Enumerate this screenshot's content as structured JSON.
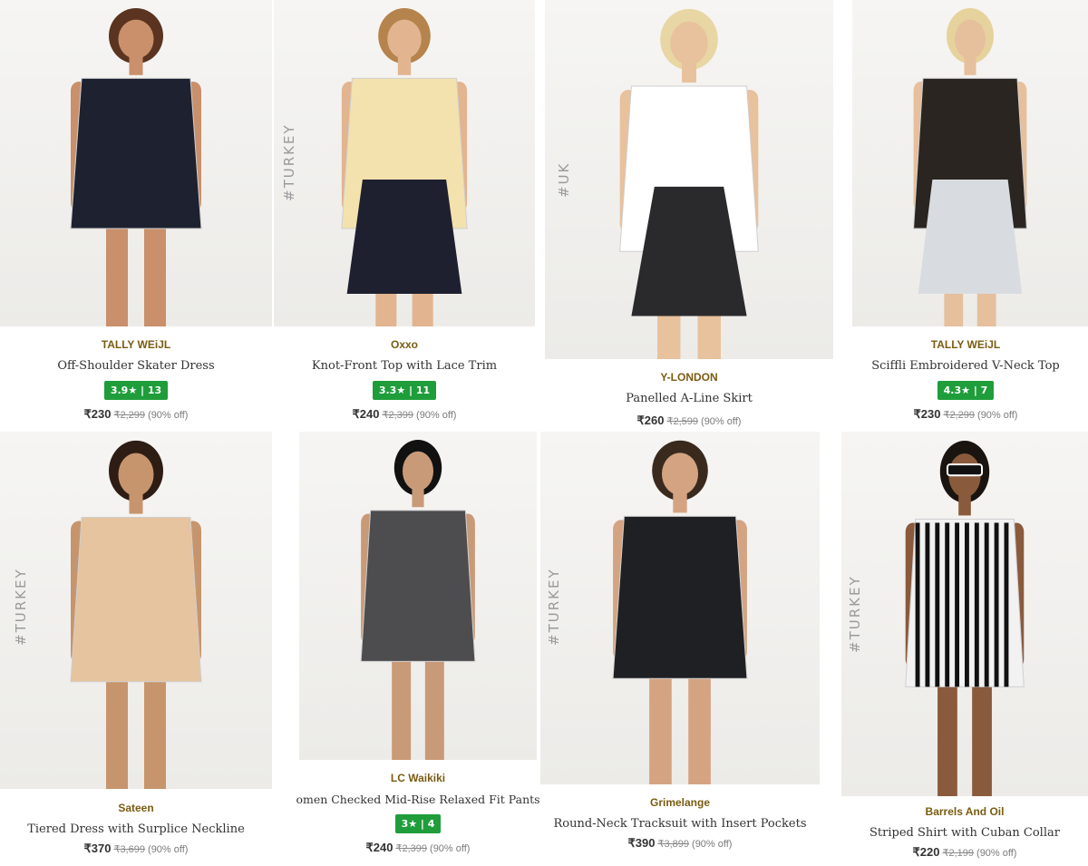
{
  "products": [
    {
      "brand": "TALLY WEiJL",
      "title": "Off-Shoulder Skater Dress",
      "rating": "3.9★ | 13",
      "price": "₹230",
      "mrp": "₹2,299",
      "discount": "(90% off)",
      "tag": "",
      "colors": {
        "outfit": "#1d2130",
        "skin": "#c9906b",
        "hair": "#5a3420"
      }
    },
    {
      "brand": "Oxxo",
      "title": "Knot-Front Top with Lace Trim",
      "rating": "3.3★ | 11",
      "price": "₹240",
      "mrp": "₹2,399",
      "discount": "(90% off)",
      "tag": "#TURKEY",
      "colors": {
        "outfit": "#f3e2ad",
        "skin": "#e2b48f",
        "hair": "#b5834c"
      }
    },
    {
      "brand": "Y-LONDON",
      "title": "Panelled A-Line Skirt",
      "rating": "",
      "price": "₹260",
      "mrp": "₹2,599",
      "discount": "(90% off)",
      "tag": "#UK",
      "colors": {
        "outfit": "#ffffff",
        "skin": "#e8c19d",
        "hair": "#e8d6a4"
      }
    },
    {
      "brand": "TALLY WEiJL",
      "title": "Sciffli Embroidered V-Neck Top",
      "rating": "4.3★ | 7",
      "price": "₹230",
      "mrp": "₹2,299",
      "discount": "(90% off)",
      "tag": "",
      "colors": {
        "outfit": "#2a2520",
        "skin": "#e6bf9c",
        "hair": "#e6d29c"
      }
    },
    {
      "brand": "Sateen",
      "title": "Tiered Dress with Surplice Neckline",
      "rating": "",
      "price": "₹370",
      "mrp": "₹3,699",
      "discount": "(90% off)",
      "tag": "#TURKEY",
      "colors": {
        "outfit": "#e5c49f",
        "skin": "#c7956d",
        "hair": "#2d1d14"
      }
    },
    {
      "brand": "LC Waikiki",
      "title": "omen Checked Mid-Rise Relaxed Fit Pants",
      "rating": "3★ | 4",
      "price": "₹240",
      "mrp": "₹2,399",
      "discount": "(90% off)",
      "tag": "",
      "colors": {
        "outfit": "#4d4d4f",
        "skin": "#c99a78",
        "hair": "#111111"
      }
    },
    {
      "brand": "Grimelange",
      "title": "Round-Neck Tracksuit with Insert Pockets",
      "rating": "",
      "price": "₹390",
      "mrp": "₹3,899",
      "discount": "(90% off)",
      "tag": "#TURKEY",
      "colors": {
        "outfit": "#1f2023",
        "skin": "#d4a482",
        "hair": "#3a2a1e"
      }
    },
    {
      "brand": "Barrels And Oil",
      "title": "Striped Shirt with Cuban Collar",
      "rating": "",
      "price": "₹220",
      "mrp": "₹2,199",
      "discount": "(90% off)",
      "tag": "#TURKEY",
      "colors": {
        "outfit": "#f2f2f2",
        "skin": "#8a5a3c",
        "hair": "#1a1410"
      }
    }
  ],
  "theme": {
    "rating_bg": "#1f9d3b",
    "brand_color": "#7a5c12"
  }
}
